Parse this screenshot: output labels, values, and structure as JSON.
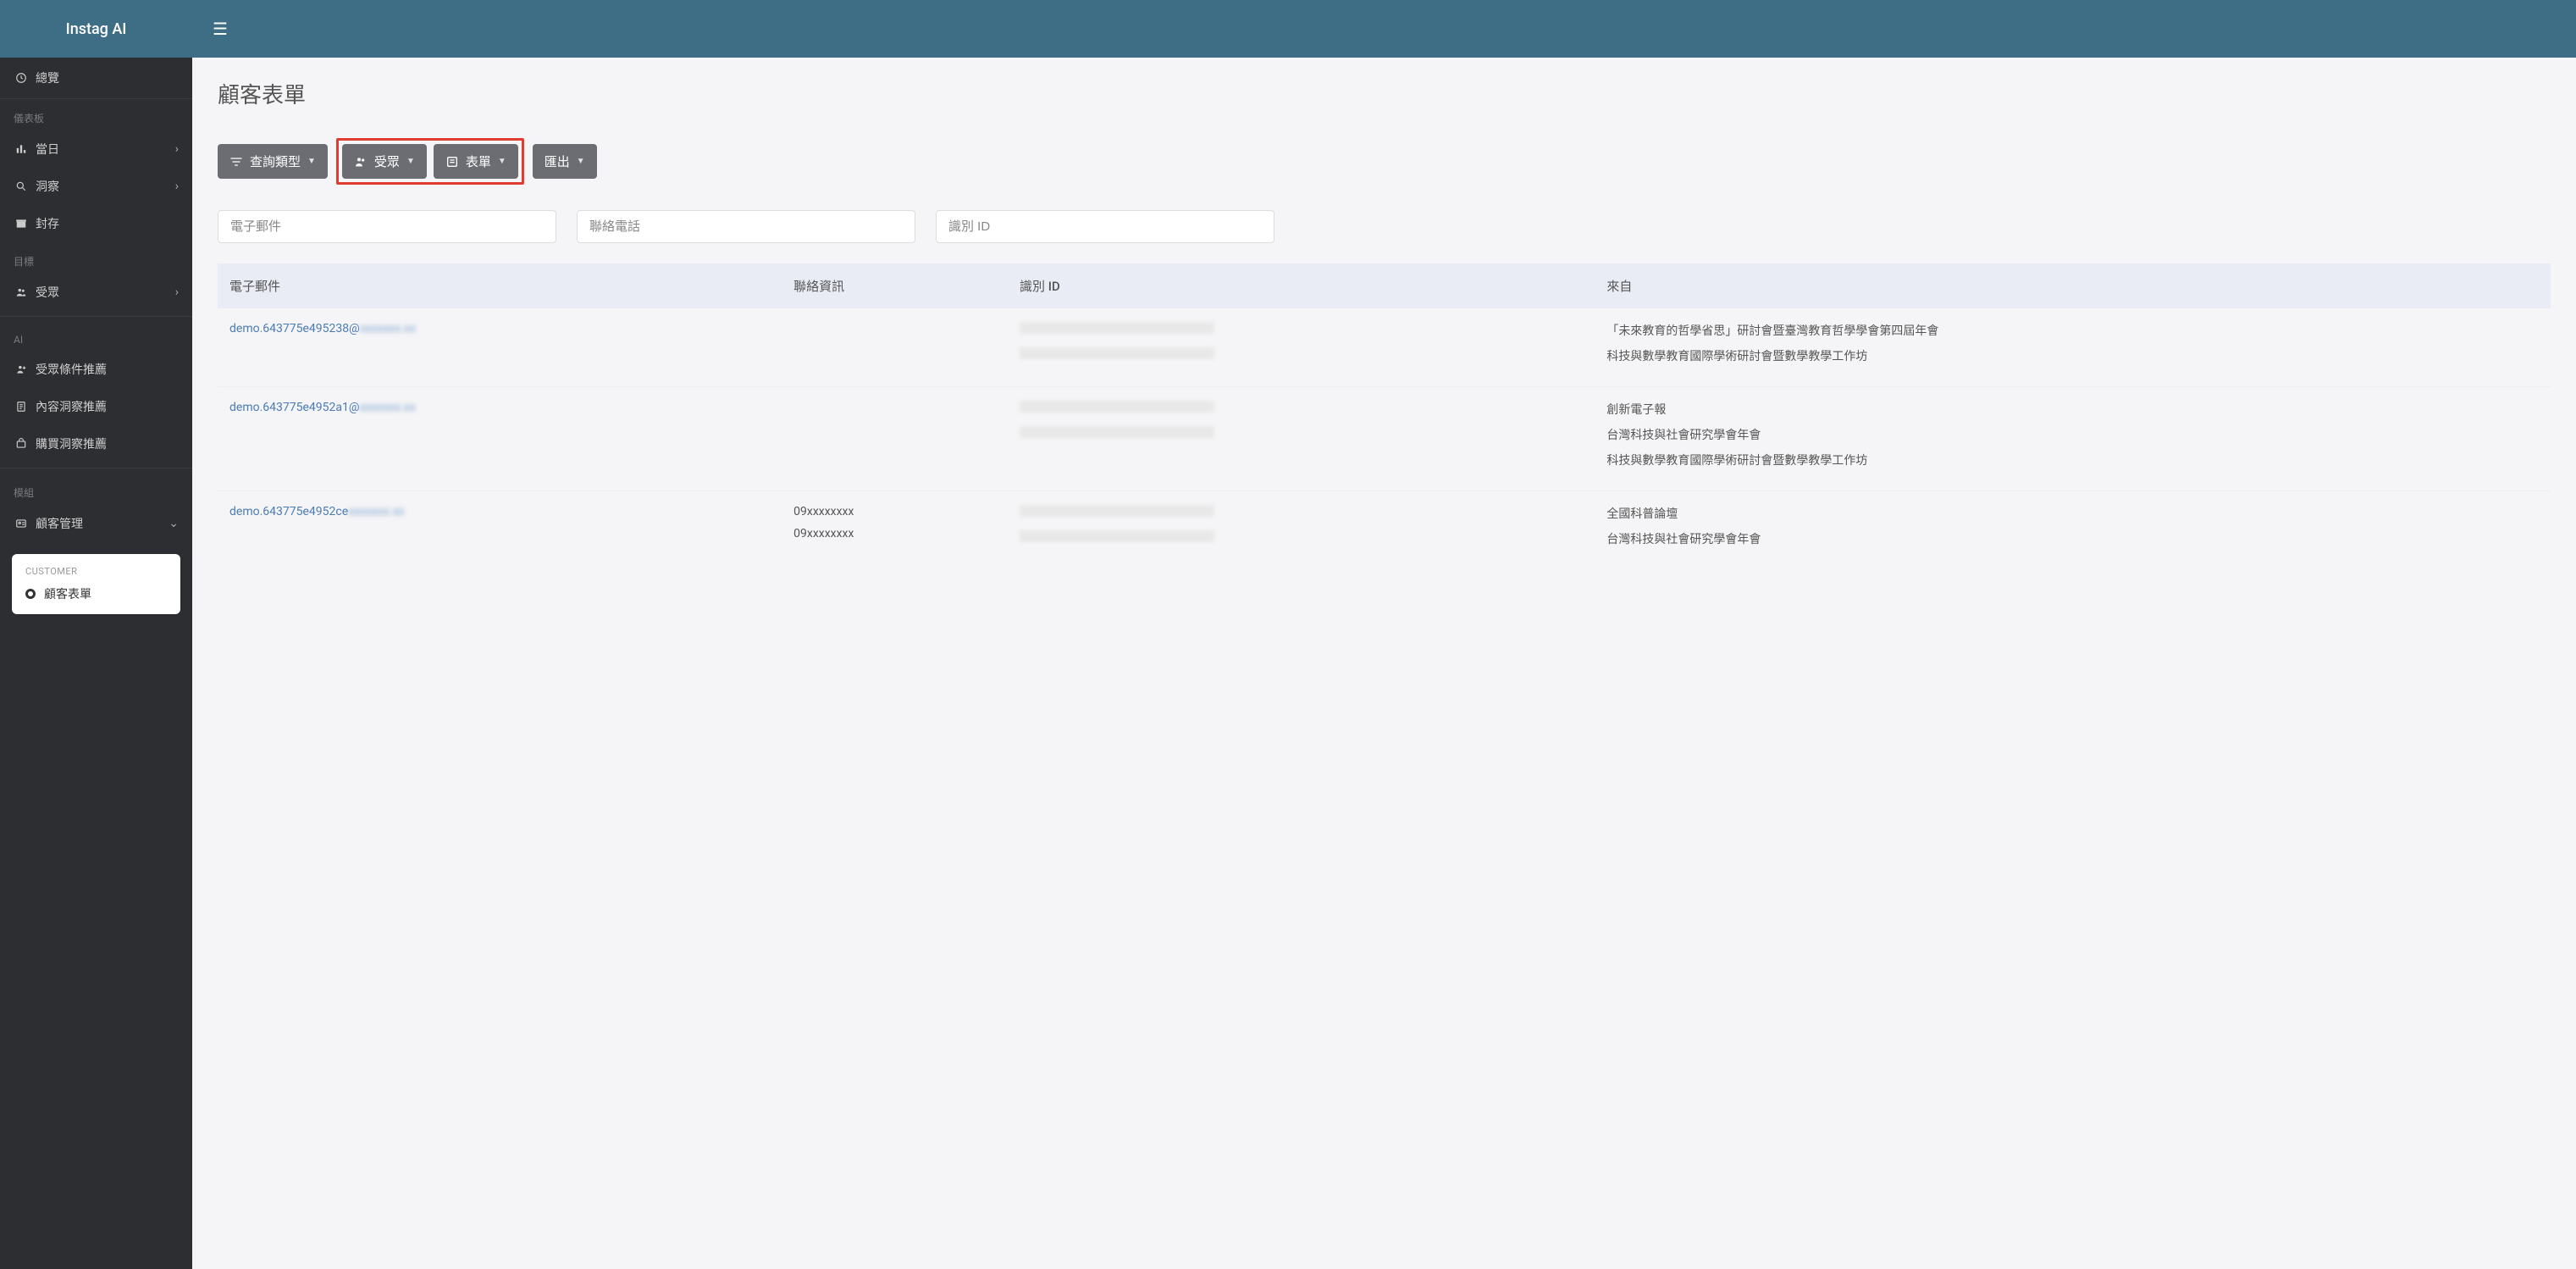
{
  "brand": "Instag AI",
  "sidebar": {
    "overview": "總覽",
    "section_dashboard": "儀表板",
    "items_dashboard": [
      {
        "label": "當日"
      },
      {
        "label": "洞察"
      },
      {
        "label": "封存"
      }
    ],
    "section_goal": "目標",
    "item_audience": "受眾",
    "section_ai": "AI",
    "items_ai": [
      {
        "label": "受眾條件推薦"
      },
      {
        "label": "內容洞察推薦"
      },
      {
        "label": "購買洞察推薦"
      }
    ],
    "section_module": "模組",
    "item_customer_mgmt": "顧客管理",
    "subcard_label": "CUSTOMER",
    "subcard_item": "顧客表單"
  },
  "page": {
    "title": "顧客表單"
  },
  "toolbar": {
    "query_type": "查詢類型",
    "audience": "受眾",
    "form": "表單",
    "export": "匯出"
  },
  "filters": {
    "email_placeholder": "電子郵件",
    "phone_placeholder": "聯絡電話",
    "id_placeholder": "識別 ID"
  },
  "table": {
    "headers": {
      "email": "電子郵件",
      "contact": "聯絡資訊",
      "id": "識別 ID",
      "from": "來自"
    },
    "rows": [
      {
        "email_prefix": "demo.643775e495238@",
        "contact": "",
        "from": [
          "「未來教育的哲學省思」研討會暨臺灣教育哲學學會第四屆年會",
          "科技與數學教育國際學術研討會暨數學教學工作坊"
        ]
      },
      {
        "email_prefix": "demo.643775e4952a1@",
        "contact": "",
        "from": [
          "創新電子報",
          "台灣科技與社會研究學會年會",
          "科技與數學教育國際學術研討會暨數學教學工作坊"
        ]
      },
      {
        "email_prefix": "demo.643775e4952ce",
        "contact": "09xxxxxxxx",
        "contact2": "09xxxxxxxx",
        "from": [
          "全國科普論壇",
          "台灣科技與社會研究學會年會"
        ]
      }
    ]
  }
}
